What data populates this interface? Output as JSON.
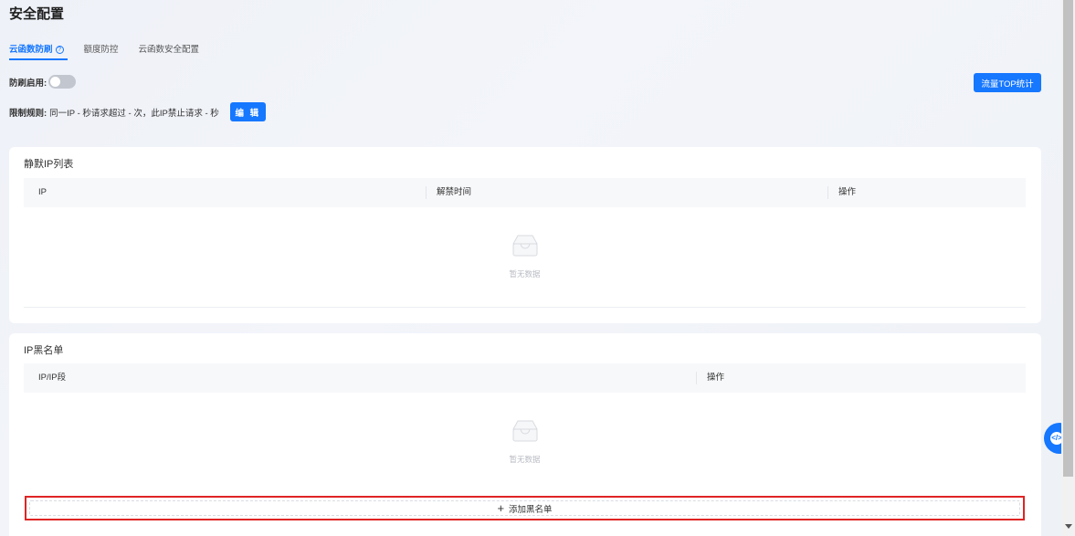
{
  "page": {
    "title": "安全配置"
  },
  "tabs": [
    {
      "label": "云函数防刷",
      "active": true
    },
    {
      "label": "额度防控",
      "active": false
    },
    {
      "label": "云函数安全配置",
      "active": false
    }
  ],
  "antiBrush": {
    "switch_label": "防刷启用:",
    "enabled": false,
    "rule_label": "限制规则:",
    "rule_text": "同一IP - 秒请求超过 - 次，此IP禁止请求 - 秒",
    "edit_label": "编 辑"
  },
  "top_stats_label": "流量TOP统计",
  "silentList": {
    "title": "静默IP列表",
    "columns": [
      "IP",
      "解禁时间",
      "操作"
    ],
    "empty_text": "暂无数据"
  },
  "blacklist": {
    "title": "IP黑名单",
    "columns": [
      "IP/IP段",
      "操作"
    ],
    "empty_text": "暂无数据",
    "add_label": "添加黑名单",
    "add_icon": "plus-icon"
  },
  "colors": {
    "primary": "#1677ff",
    "highlight_border": "#e02424"
  }
}
